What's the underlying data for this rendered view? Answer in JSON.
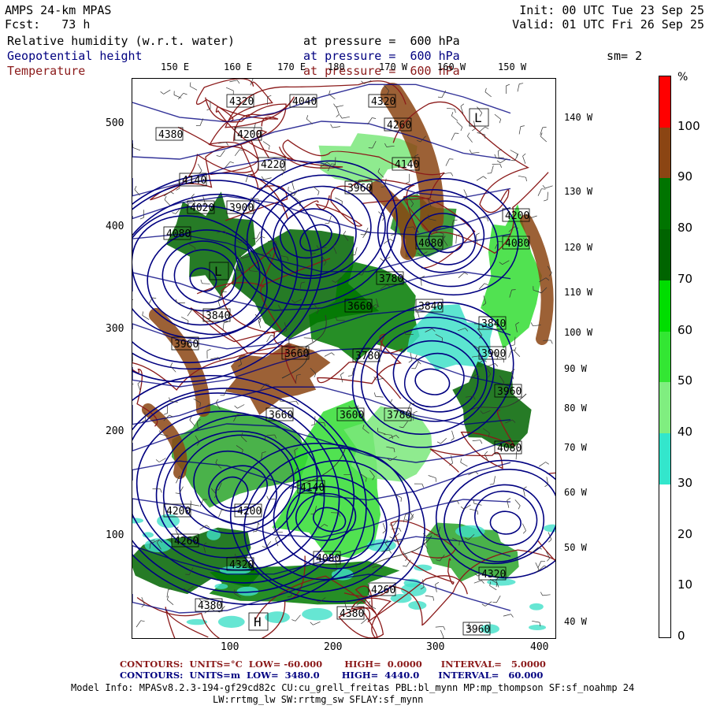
{
  "header": {
    "model": "AMPS 24-km MPAS",
    "fcst_label": "Fcst:",
    "fcst_value": "73 h",
    "init": "Init: 00 UTC Tue 23 Sep 25",
    "valid": "Valid: 01 UTC Fri 26 Sep 25",
    "fields": [
      {
        "name": "Relative humidity (w.r.t. water)",
        "level": "at pressure =  600 hPa",
        "color": "#000000"
      },
      {
        "name": "Geopotential height",
        "level": "at pressure =  600 hPa",
        "color": "#000080"
      },
      {
        "name": "Temperature",
        "level": "at pressure =  600 hPa",
        "color": "#8b1a1a"
      }
    ],
    "smooth": "sm= 2"
  },
  "map": {
    "lon_top": [
      "150 E",
      "160 E",
      "170 E",
      "180",
      "170 W",
      "160 W",
      "150 W"
    ],
    "lon_right": [
      "140 W",
      "130 W",
      "120 W",
      "110 W",
      "100 W",
      "90 W",
      "80 W",
      "70 W",
      "60 W",
      "50 W",
      "40 W"
    ],
    "x_ticks": [
      "100",
      "200",
      "300",
      "400"
    ],
    "y_ticks": [
      "500",
      "400",
      "300",
      "200",
      "100"
    ],
    "height_labels": [
      "4320",
      "4040",
      "4320",
      "4380",
      "4200",
      "4260",
      "4140",
      "4220",
      "4140",
      "3960",
      "4020",
      "3900",
      "4200",
      "4080",
      "4080",
      "4080",
      "3840",
      "3780",
      "3660",
      "3840",
      "3960",
      "3660",
      "3780",
      "3600",
      "3660",
      "3780",
      "3840",
      "3900",
      "3960",
      "4080",
      "4200",
      "4260",
      "4320",
      "4380",
      "4380",
      "4260",
      "4320",
      "4200",
      "4140",
      "4080",
      "3960"
    ],
    "low_label": "L",
    "high_label": "H"
  },
  "colorbar": {
    "unit": "%",
    "labels": [
      "100",
      "90",
      "80",
      "70",
      "60",
      "50",
      "40",
      "30",
      "20",
      "10",
      "0"
    ],
    "bands": [
      {
        "from": 100,
        "to": 110,
        "color": "#ff0000"
      },
      {
        "from": 90,
        "to": 100,
        "color": "#8b4513"
      },
      {
        "from": 80,
        "to": 90,
        "color": "#007400"
      },
      {
        "from": 70,
        "to": 80,
        "color": "#006400"
      },
      {
        "from": 60,
        "to": 70,
        "color": "#00dd00"
      },
      {
        "from": 50,
        "to": 60,
        "color": "#33e633"
      },
      {
        "from": 40,
        "to": 50,
        "color": "#80ee80"
      },
      {
        "from": 30,
        "to": 40,
        "color": "#33e6cc"
      },
      {
        "from": 20,
        "to": 30,
        "color": "#ffffff"
      },
      {
        "from": 10,
        "to": 20,
        "color": "#ffffff"
      },
      {
        "from": 0,
        "to": 10,
        "color": "#ffffff"
      }
    ]
  },
  "footer": {
    "temp_contours": "CONTOURS:  UNITS=°C  LOW= -60.000       HIGH=  0.0000      INTERVAL=   5.0000",
    "height_contours": "CONTOURS:  UNITS=m  LOW=  3480.0       HIGH=  4440.0      INTERVAL=   60.000",
    "model_info_1": "Model Info: MPASv8.2.3-194-gf29cd82c CU:cu_grell_freitas PBL:bl_mynn MP:mp_thompson SF:sf_noahmp 24",
    "model_info_2": "LW:rrtmg_lw SW:rrtmg_sw SFLAY:sf_mynn"
  },
  "colors": {
    "height_contour": "#000080",
    "temp_contour": "#8b1a1a",
    "temp_footer": "#8b1a1a",
    "height_footer": "#000080"
  }
}
